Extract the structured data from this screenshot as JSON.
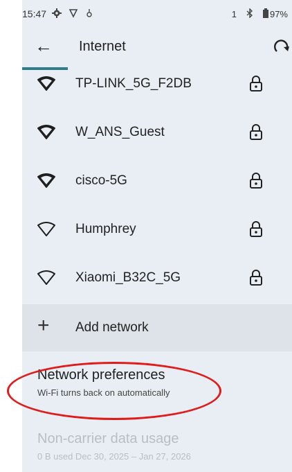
{
  "statusbar": {
    "time": "15:47",
    "sim": "1",
    "battery": "97%"
  },
  "appbar": {
    "title": "Internet"
  },
  "networks": [
    {
      "ssid": "TP-LINK_5G_F2DB",
      "signal": "full",
      "secured": true
    },
    {
      "ssid": "W_ANS_Guest",
      "signal": "full",
      "secured": true
    },
    {
      "ssid": "cisco-5G",
      "signal": "full",
      "secured": true
    },
    {
      "ssid": "Humphrey",
      "signal": "empty",
      "secured": true
    },
    {
      "ssid": "Xiaomi_B32C_5G",
      "signal": "empty",
      "secured": true
    }
  ],
  "add_network": {
    "label": "Add network"
  },
  "preferences": {
    "title": "Network preferences",
    "summary": "Wi-Fi turns back on automatically"
  },
  "usage": {
    "title": "Non-carrier data usage",
    "summary": "0 B used Dec 30, 2025 – Jan 27, 2026"
  },
  "colors": {
    "background": "#e8eef3",
    "accent": "#2f7d8c",
    "annotation": "#e01b1b"
  },
  "icons": [
    "gear-icon",
    "shield-icon",
    "vibrate-icon",
    "bluetooth-icon",
    "battery-icon",
    "back-arrow-icon",
    "refresh-icon",
    "wifi-icon",
    "lock-icon",
    "plus-icon"
  ]
}
